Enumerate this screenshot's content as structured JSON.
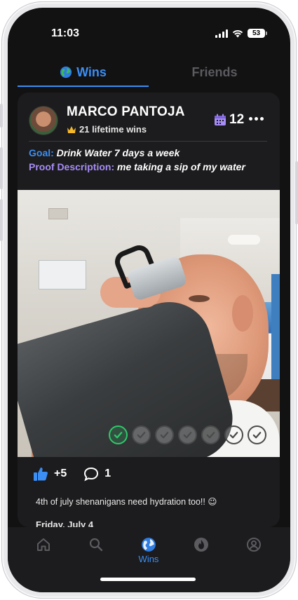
{
  "status_bar": {
    "time": "11:03",
    "battery": "53"
  },
  "tabs": [
    {
      "label": "Wins",
      "icon": "globe-icon",
      "active": true
    },
    {
      "label": "Friends",
      "icon": "",
      "active": false
    }
  ],
  "post": {
    "user_name": "MARCO PANTOJA",
    "lifetime_wins": "21 lifetime wins",
    "streak_count": "12",
    "goal_label": "Goal:",
    "goal_value": "Drink Water 7 days a week",
    "proof_label": "Proof Description:",
    "proof_value": "me taking a sip of my water",
    "checks_done": 1,
    "checks_total": 7,
    "likes": "+5",
    "comments": "1",
    "caption": "4th of july shenanigans need hydration too!! 😉",
    "date": "Friday, July 4"
  },
  "bottom_nav": [
    {
      "name": "home-icon",
      "label": ""
    },
    {
      "name": "search-icon",
      "label": ""
    },
    {
      "name": "globe-icon",
      "label": "Wins",
      "active": true
    },
    {
      "name": "flame-icon",
      "label": ""
    },
    {
      "name": "profile-icon",
      "label": ""
    }
  ],
  "colors": {
    "accent": "#3b8ef3",
    "proof": "#a68cf5",
    "check_done": "#2ec96a",
    "background": "#121213",
    "card": "#1c1c1e"
  }
}
